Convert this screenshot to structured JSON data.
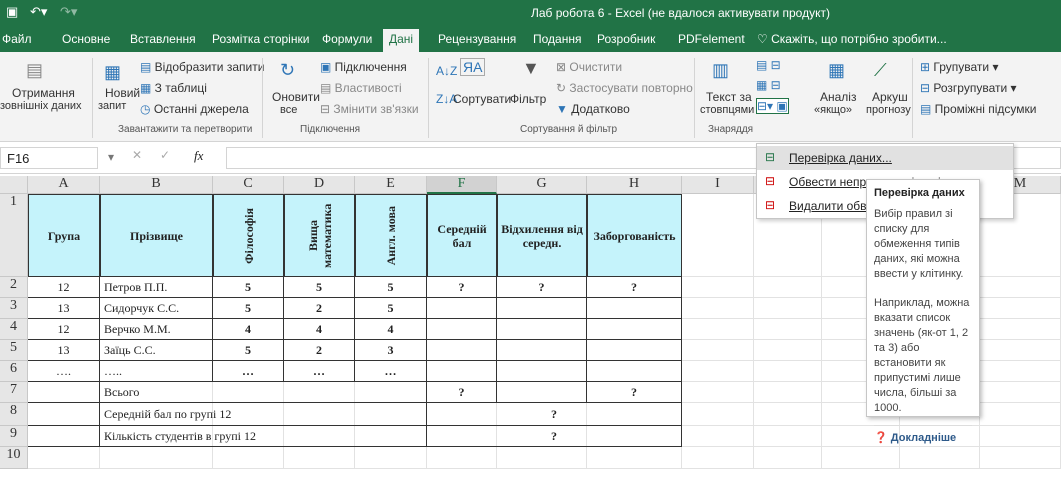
{
  "window": {
    "title": "Лаб робота 6 - Excel (не вдалося активувати продукт)"
  },
  "tabs": [
    "Файл",
    "Основне",
    "Вставлення",
    "Розмітка сторінки",
    "Формули",
    "Дані",
    "Рецензування",
    "Подання",
    "Розробник",
    "PDFelement"
  ],
  "tell_me": "Скажіть, що потрібно зробити...",
  "ribbon": {
    "get_ext": "Отримання",
    "get_ext2": "зовнішніх даних",
    "new_query": "Новий",
    "new_query2": "запит",
    "show_queries": "Відобразити запити",
    "from_table": "З таблиці",
    "recent": "Останні джерела",
    "grp_get": "Завантажити та перетворити",
    "refresh": "Оновити",
    "refresh2": "все",
    "connections": "Підключення",
    "properties": "Властивості",
    "edit_links": "Змінити зв'язки",
    "grp_conn": "Підключення",
    "sort": "Сортувати",
    "filter": "Фільтр",
    "clear": "Очистити",
    "reapply": "Застосувати повторно",
    "advanced": "Додатково",
    "grp_sort": "Сортування й фільтр",
    "text_cols": "Текст за",
    "text_cols2": "стовпцями",
    "grp_tools": "Знаряддя",
    "whatif": "Аналіз",
    "whatif2": "«якщо»",
    "forecast": "Аркуш",
    "forecast2": "прогнозу",
    "group": "Групувати",
    "ungroup": "Розгрупувати",
    "subtotal": "Проміжні підсумки"
  },
  "formula_bar": {
    "name_box": "F16",
    "fx": "fx"
  },
  "columns": [
    "A",
    "B",
    "C",
    "D",
    "E",
    "F",
    "G",
    "H",
    "I",
    "J",
    "K",
    "L",
    "M"
  ],
  "rows": [
    "1",
    "2",
    "3",
    "4",
    "5",
    "6",
    "7",
    "8",
    "9",
    "10"
  ],
  "table": {
    "headers": [
      "Група",
      "Прізвище",
      "Філософія",
      "Вища математика",
      "Англ. мова",
      "Середній бал",
      "Відхилення від середн.",
      "Заборгованість"
    ],
    "data": [
      [
        "12",
        "Петров П.П.",
        "5",
        "5",
        "5",
        "?",
        "?",
        "?"
      ],
      [
        "13",
        "Сидорчук С.С.",
        "5",
        "2",
        "5",
        "",
        "",
        ""
      ],
      [
        "12",
        "Верчко М.М.",
        "4",
        "4",
        "4",
        "",
        "",
        ""
      ],
      [
        "13",
        "Заїць С.С.",
        "5",
        "2",
        "3",
        "",
        "",
        ""
      ],
      [
        "….",
        "…..",
        "…",
        "…",
        "…",
        "",
        "",
        ""
      ]
    ],
    "total_label": "Всього",
    "total_f": "?",
    "total_h": "?",
    "avg12_label": "Середній бал по групі 12",
    "avg12_val": "?",
    "count12_label": "Кількість студентів в групі 12",
    "count12_val": "?"
  },
  "menu": {
    "items": [
      "Перевірка даних...",
      "Обвести неприпустимі дані",
      "Видалити обвідні ліній"
    ]
  },
  "tooltip": {
    "title": "Перевірка даних",
    "body1": "Вибір правил зі списку для обмеження типів даних, які можна ввести у клітинку.",
    "body2": "Наприклад, можна вказати список значень (як-от 1, 2 та 3) або встановити як припустимі лише числа, більші за 1000.",
    "more": "Докладніше"
  }
}
